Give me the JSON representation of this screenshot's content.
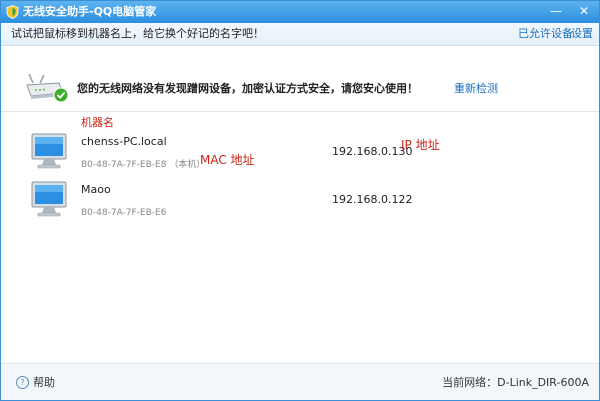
{
  "window": {
    "title": "无线安全助手-QQ电脑管家",
    "minimize_glyph": "—",
    "close_glyph": "✕"
  },
  "hint": {
    "text": "试试把鼠标移到机器名上，给它换个好记的名字吧！",
    "allowed_devices_link": "已允许设备",
    "settings_link": "设置"
  },
  "status": {
    "message": "您的无线网络没有发现蹭网设备，加密认证方式安全，请您安心使用！",
    "recheck_link": "重新检测"
  },
  "annotations": {
    "machine_name": "机器名",
    "mac_address": "MAC 地址",
    "ip_address": "IP 地址"
  },
  "devices": [
    {
      "name": "chenss-PC.local",
      "mac": "B0-48-7A-7F-EB-E8",
      "self_tag": "（本机）",
      "ip": "192.168.0.130"
    },
    {
      "name": "Maoo",
      "mac": "B0-48-7A-7F-EB-E6",
      "self_tag": "",
      "ip": "192.168.0.122"
    }
  ],
  "footer": {
    "help_glyph": "?",
    "help_label": "帮助",
    "current_network_label": "当前网络：",
    "current_network_value": "D-Link_DIR-600A"
  },
  "colors": {
    "titlebar": "#2d8fe0",
    "link": "#1d6fc2",
    "annotation": "#c8261a",
    "check_badge": "#3fae2f"
  },
  "icons": {
    "title": "shield-icon",
    "status": "router-check-icon",
    "device": "computer-monitor-icon",
    "help": "help-icon"
  }
}
